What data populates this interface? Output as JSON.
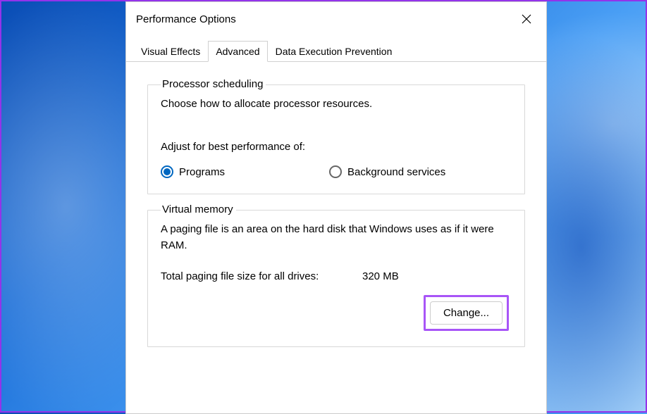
{
  "dialog": {
    "title": "Performance Options",
    "tabs": [
      {
        "label": "Visual Effects",
        "active": false
      },
      {
        "label": "Advanced",
        "active": true
      },
      {
        "label": "Data Execution Prevention",
        "active": false
      }
    ]
  },
  "processor": {
    "legend": "Processor scheduling",
    "desc": "Choose how to allocate processor resources.",
    "adjust_label": "Adjust for best performance of:",
    "options": [
      {
        "label": "Programs",
        "selected": true
      },
      {
        "label": "Background services",
        "selected": false
      }
    ]
  },
  "virtual_memory": {
    "legend": "Virtual memory",
    "desc": "A paging file is an area on the hard disk that Windows uses as if it were RAM.",
    "total_label": "Total paging file size for all drives:",
    "total_value": "320 MB",
    "change_button": "Change..."
  }
}
